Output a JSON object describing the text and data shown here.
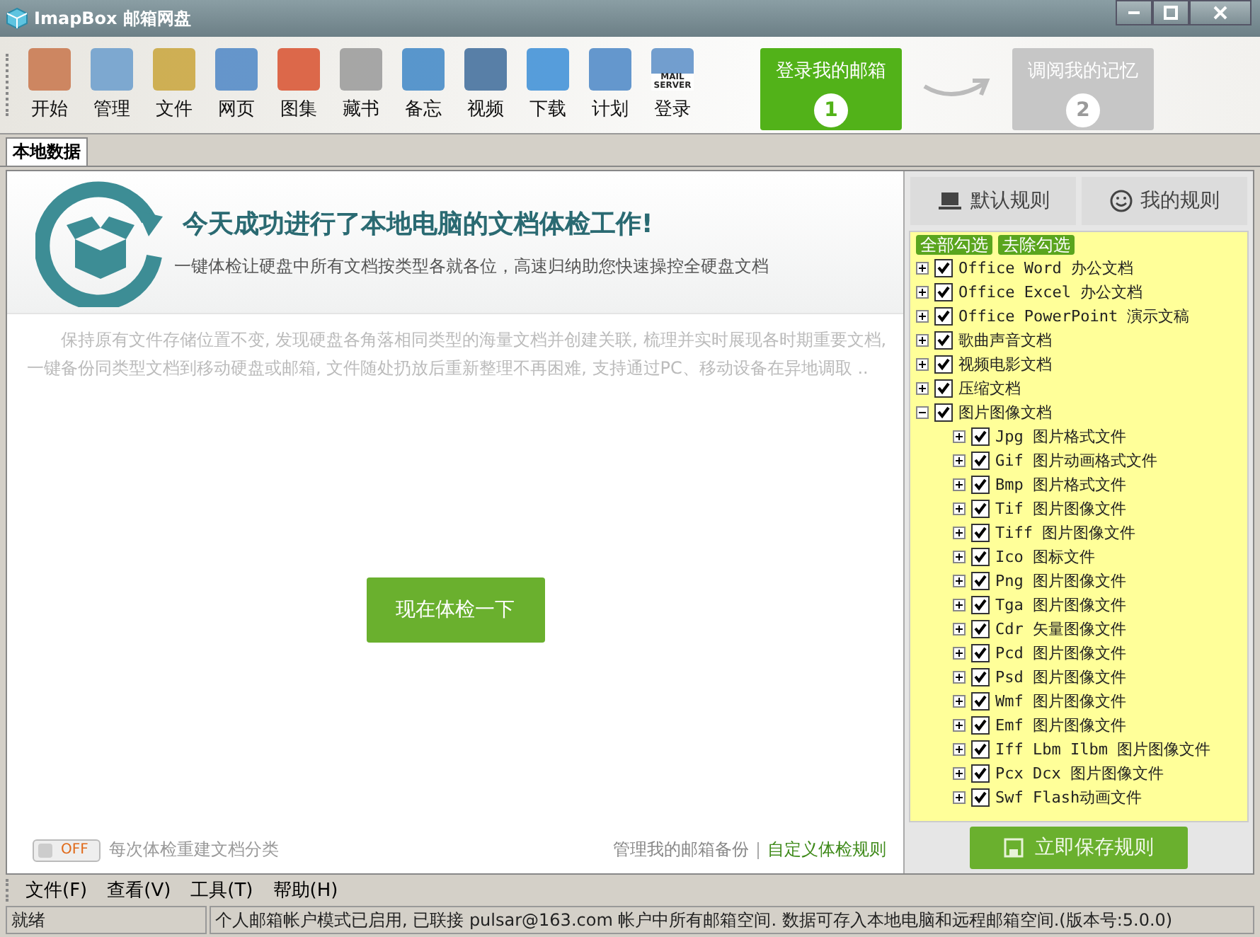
{
  "window": {
    "title": "ImapBox 邮箱网盘"
  },
  "toolbar": [
    {
      "label": "开始"
    },
    {
      "label": "管理"
    },
    {
      "label": "文件"
    },
    {
      "label": "网页"
    },
    {
      "label": "图集"
    },
    {
      "label": "藏书"
    },
    {
      "label": "备忘"
    },
    {
      "label": "视频"
    },
    {
      "label": "下载"
    },
    {
      "label": "计划"
    },
    {
      "label": "登录",
      "icon_text": "MAIL SERVER"
    }
  ],
  "steps": [
    {
      "label": "登录我的邮箱",
      "number": "1",
      "selected": true
    },
    {
      "label": "调阅我的记忆",
      "number": "2",
      "selected": false
    }
  ],
  "tabs": [
    {
      "label": "本地数据",
      "selected": true
    }
  ],
  "banner": {
    "title": "今天成功进行了本地电脑的文档体检工作!",
    "subtitle": "一键体检让硬盘中所有文档按类型各就各位，高速归纳助您快速操控全硬盘文档"
  },
  "description": "保持原有文件存储位置不变, 发现硬盘各角落相同类型的海量文档并创建关联, 梳理并实时展现各时期重要文档, 一键备份同类型文档到移动硬盘或邮箱, 文件随处扔放后重新整理不再困难, 支持通过PC、移动设备在异地调取 ..",
  "check_button": "现在体检一下",
  "rebuild_toggle": {
    "on": false,
    "state_text": "OFF",
    "label": "每次体检重建文档分类"
  },
  "links": [
    "管理我的邮箱备份",
    "自定义体检规则"
  ],
  "rule_tabs": [
    {
      "label": "默认规则",
      "selected": false
    },
    {
      "label": "我的规则",
      "selected": false
    }
  ],
  "rule_actions": [
    "全部勾选",
    "去除勾选"
  ],
  "rules": [
    {
      "label": "Office Word 办公文档",
      "checked": true,
      "expanded": false
    },
    {
      "label": "Office Excel 办公文档",
      "checked": true,
      "expanded": false
    },
    {
      "label": "Office PowerPoint 演示文稿",
      "checked": true,
      "expanded": false
    },
    {
      "label": "歌曲声音文档",
      "checked": true,
      "expanded": false
    },
    {
      "label": "视频电影文档",
      "checked": true,
      "expanded": false
    },
    {
      "label": "压缩文档",
      "checked": true,
      "expanded": false
    },
    {
      "label": "图片图像文档",
      "checked": true,
      "expanded": true,
      "children": [
        {
          "label": "Jpg 图片格式文件",
          "checked": true,
          "expanded": false
        },
        {
          "label": "Gif 图片动画格式文件",
          "checked": true,
          "expanded": false
        },
        {
          "label": "Bmp 图片格式文件",
          "checked": true,
          "expanded": false
        },
        {
          "label": "Tif 图片图像文件",
          "checked": true,
          "expanded": false
        },
        {
          "label": "Tiff 图片图像文件",
          "checked": true,
          "expanded": false
        },
        {
          "label": "Ico 图标文件",
          "checked": true,
          "expanded": false
        },
        {
          "label": "Png 图片图像文件",
          "checked": true,
          "expanded": false
        },
        {
          "label": "Tga 图片图像文件",
          "checked": true,
          "expanded": false
        },
        {
          "label": "Cdr 矢量图像文件",
          "checked": true,
          "expanded": false
        },
        {
          "label": "Pcd 图片图像文件",
          "checked": true,
          "expanded": false
        },
        {
          "label": "Psd 图片图像文件",
          "checked": true,
          "expanded": false
        },
        {
          "label": "Wmf 图片图像文件",
          "checked": true,
          "expanded": false
        },
        {
          "label": "Emf 图片图像文件",
          "checked": true,
          "expanded": false
        },
        {
          "label": "Iff Lbm Ilbm 图片图像文件",
          "checked": true,
          "expanded": false
        },
        {
          "label": "Pcx Dcx 图片图像文件",
          "checked": true,
          "expanded": false
        },
        {
          "label": "Swf Flash动画文件",
          "checked": true,
          "expanded": false
        }
      ]
    }
  ],
  "save_button": "立即保存规则",
  "menu": [
    "文件(F)",
    "查看(V)",
    "工具(T)",
    "帮助(H)"
  ],
  "status_bar": [
    "就绪",
    "个人邮箱帐户模式已启用, 已联接 pulsar@163.com 帐户中所有邮箱空间. 数据可存入本地电脑和远程邮箱空间.(版本号:5.0.0)"
  ]
}
